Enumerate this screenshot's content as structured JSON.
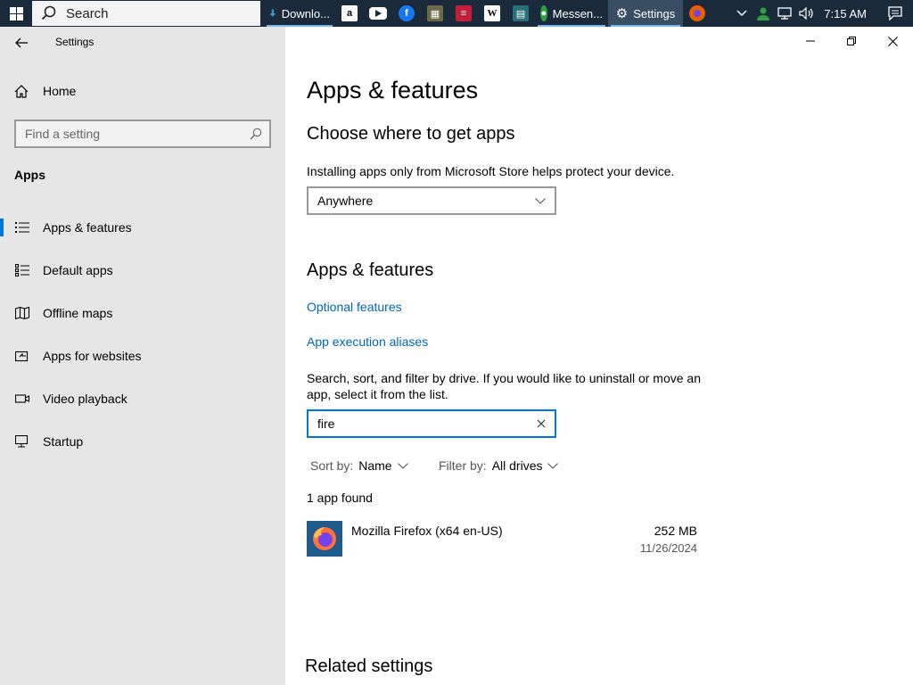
{
  "taskbar": {
    "search_label": "Search",
    "apps": [
      {
        "name": "downloads",
        "label": "Downlo..."
      },
      {
        "name": "amazon",
        "label": ""
      },
      {
        "name": "youtube",
        "label": ""
      },
      {
        "name": "facebook",
        "label": ""
      },
      {
        "name": "app5",
        "label": ""
      },
      {
        "name": "app6",
        "label": ""
      },
      {
        "name": "wikipedia",
        "label": ""
      },
      {
        "name": "app8",
        "label": ""
      },
      {
        "name": "messenger",
        "label": "Messen..."
      },
      {
        "name": "settings",
        "label": "Settings"
      },
      {
        "name": "firefox",
        "label": ""
      }
    ],
    "clock": "7:15 AM"
  },
  "sidebar": {
    "title": "Settings",
    "home": "Home",
    "find_placeholder": "Find a setting",
    "section": "Apps",
    "items": [
      {
        "label": "Apps & features",
        "icon": "list-icon",
        "selected": true
      },
      {
        "label": "Default apps",
        "icon": "default-apps-icon",
        "selected": false
      },
      {
        "label": "Offline maps",
        "icon": "map-icon",
        "selected": false
      },
      {
        "label": "Apps for websites",
        "icon": "web-app-icon",
        "selected": false
      },
      {
        "label": "Video playback",
        "icon": "video-icon",
        "selected": false
      },
      {
        "label": "Startup",
        "icon": "startup-icon",
        "selected": false
      }
    ]
  },
  "main": {
    "title": "Apps & features",
    "choose_heading": "Choose where to get apps",
    "choose_desc": "Installing apps only from Microsoft Store helps protect your device.",
    "source_value": "Anywhere",
    "features_heading": "Apps & features",
    "optional_link": "Optional features",
    "aliases_link": "App execution aliases",
    "search_desc_1": "Search, sort, and filter by drive. If you would like to uninstall or move an",
    "search_desc_2": "app, select it from the list.",
    "search_value": "fire",
    "sort_label": "Sort by:",
    "sort_value": "Name",
    "filter_label": "Filter by:",
    "filter_value": "All drives",
    "count_text": "1 app found",
    "apps": [
      {
        "name": "Mozilla Firefox (x64 en-US)",
        "size": "252 MB",
        "date": "11/26/2024"
      }
    ],
    "related_heading": "Related settings"
  },
  "colors": {
    "accent": "#0078d7",
    "link": "#0067b8",
    "taskbar": "#1b2a3a",
    "sidebar": "#e6e6e6"
  }
}
